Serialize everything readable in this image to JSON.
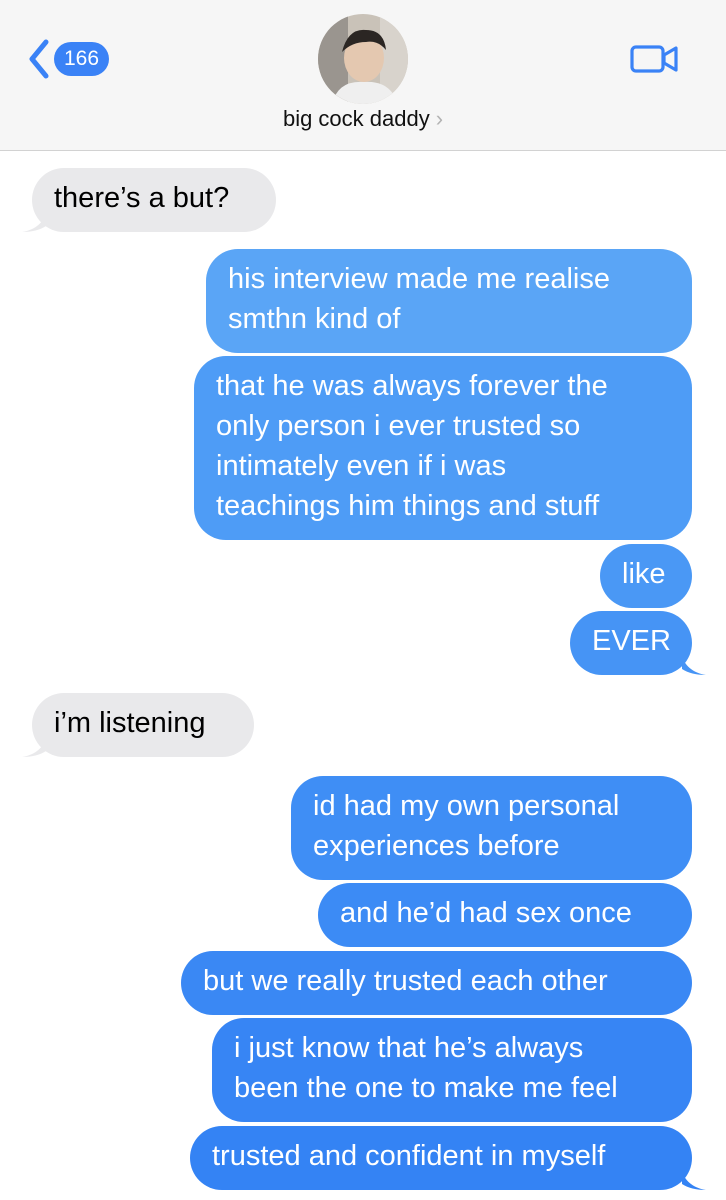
{
  "header": {
    "back_count": "166",
    "contact_name": "big cock daddy",
    "contact_chevron": "›",
    "icons": {
      "back": "chevron-left-icon",
      "video": "video-camera-icon"
    },
    "accent_color": "#3a82f6"
  },
  "messages": [
    {
      "direction": "incoming",
      "lines": [
        "there’s a but?"
      ]
    },
    {
      "direction": "outgoing",
      "lines": [
        "his interview made me realise",
        "smthn kind of"
      ]
    },
    {
      "direction": "outgoing",
      "lines": [
        "that he was always forever the",
        "only person i ever trusted so",
        "intimately even if i was",
        "teachings him things and stuff"
      ]
    },
    {
      "direction": "outgoing",
      "lines": [
        "like"
      ]
    },
    {
      "direction": "outgoing",
      "lines": [
        "EVER"
      ]
    },
    {
      "direction": "incoming",
      "lines": [
        "i’m listening"
      ]
    },
    {
      "direction": "outgoing",
      "lines": [
        "id had my own personal",
        "experiences before"
      ]
    },
    {
      "direction": "outgoing",
      "lines": [
        "and he’d had sex once"
      ]
    },
    {
      "direction": "outgoing",
      "lines": [
        "but we really trusted each other"
      ]
    },
    {
      "direction": "outgoing",
      "lines": [
        "i just know that he’s always",
        "been the one to make me feel"
      ]
    },
    {
      "direction": "outgoing",
      "lines": [
        "trusted and confident in myself"
      ]
    }
  ]
}
